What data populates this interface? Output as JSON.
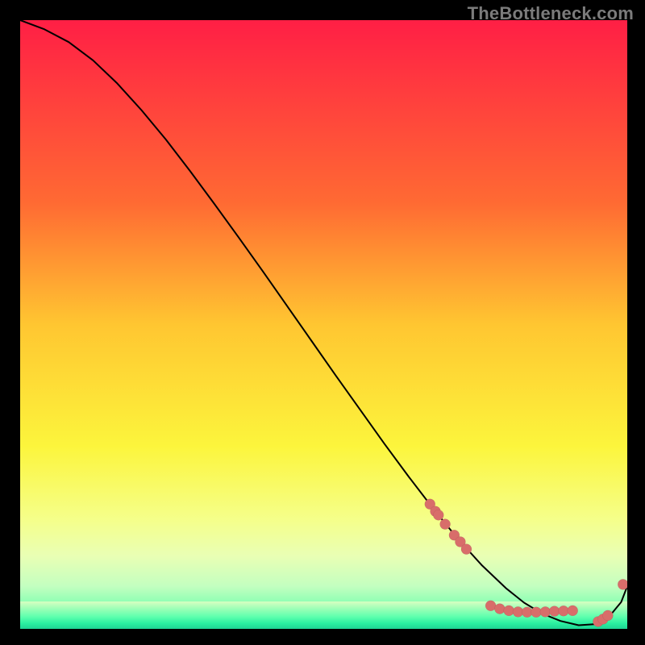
{
  "watermark": "TheBottleneck.com",
  "chart_data": {
    "type": "line",
    "title": "",
    "xlabel": "",
    "ylabel": "",
    "xlim": [
      0,
      100
    ],
    "ylim": [
      0,
      100
    ],
    "grid": false,
    "gradient_stops": [
      {
        "offset": 0.0,
        "color": "#ff1f45"
      },
      {
        "offset": 0.3,
        "color": "#ff6a33"
      },
      {
        "offset": 0.5,
        "color": "#ffc631"
      },
      {
        "offset": 0.7,
        "color": "#fcf53c"
      },
      {
        "offset": 0.82,
        "color": "#f5ff8a"
      },
      {
        "offset": 0.88,
        "color": "#e9ffb4"
      },
      {
        "offset": 0.93,
        "color": "#c3ffc0"
      },
      {
        "offset": 0.965,
        "color": "#7dffb0"
      },
      {
        "offset": 1.0,
        "color": "#28e599"
      }
    ],
    "series": [
      {
        "name": "curve",
        "type": "line",
        "color": "#000000",
        "x": [
          0,
          4,
          8,
          12,
          16,
          20,
          24,
          28,
          32,
          36,
          40,
          44,
          48,
          52,
          56,
          60,
          64,
          68,
          72,
          76,
          80,
          83,
          86,
          89,
          92,
          95,
          97,
          99,
          100
        ],
        "y": [
          100,
          98.5,
          96.4,
          93.4,
          89.6,
          85.2,
          80.4,
          75.2,
          69.8,
          64.3,
          58.7,
          53.0,
          47.3,
          41.6,
          36.0,
          30.4,
          25.0,
          19.8,
          14.9,
          10.5,
          6.7,
          4.3,
          2.5,
          1.3,
          0.6,
          0.8,
          2.0,
          4.4,
          7.0
        ]
      },
      {
        "name": "markers-upper",
        "type": "scatter",
        "color": "#d86d6a",
        "x": [
          67.5,
          68.4,
          68.9,
          70.0,
          71.5,
          72.5,
          73.5
        ],
        "y": [
          20.5,
          19.3,
          18.7,
          17.2,
          15.4,
          14.3,
          13.1
        ]
      },
      {
        "name": "markers-bottom",
        "type": "scatter",
        "color": "#d86d6a",
        "x": [
          77.5,
          79.0,
          80.5,
          82.0,
          83.5,
          85.0,
          86.5,
          88.0,
          89.5,
          91.0
        ],
        "y": [
          3.8,
          3.3,
          3.0,
          2.8,
          2.75,
          2.75,
          2.8,
          2.9,
          2.95,
          3.0
        ]
      },
      {
        "name": "markers-right",
        "type": "scatter",
        "color": "#d86d6a",
        "x": [
          95.2,
          96.0,
          96.8,
          99.3
        ],
        "y": [
          1.2,
          1.6,
          2.2,
          7.3
        ]
      }
    ],
    "annotations": [
      {
        "x": 84,
        "y": 2.7,
        "text": "",
        "series": "markers-bottom"
      }
    ]
  }
}
